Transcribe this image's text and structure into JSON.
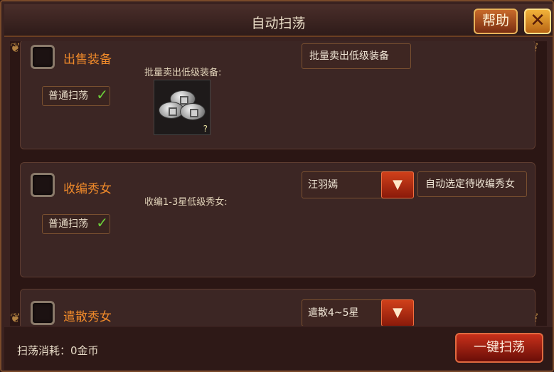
{
  "header": {
    "title": "自动扫荡",
    "help_label": "帮助",
    "close_glyph": "✕"
  },
  "sections": [
    {
      "title": "出售装备",
      "tag": "普通扫荡",
      "label": "批量卖出低级装备:",
      "action": "批量卖出低级装备",
      "item_icon": "silver-coins-icon",
      "item_qmark": "?"
    },
    {
      "title": "收编秀女",
      "tag": "普通扫荡",
      "label": "收编1-3星低级秀女:",
      "select_value": "汪羽嫣",
      "action": "自动选定待收编秀女"
    },
    {
      "title": "遣散秀女",
      "select_value": "遣散4~5星"
    }
  ],
  "footer": {
    "cost_label": "扫荡消耗：0金币",
    "sweep_button": "一键扫荡"
  },
  "icons": {
    "check": "check-icon",
    "dropdown": "triangle-down-icon"
  },
  "colors": {
    "accent_orange": "#f08a2a",
    "check_green": "#6ccf3a",
    "danger_red": "#c8301a"
  }
}
